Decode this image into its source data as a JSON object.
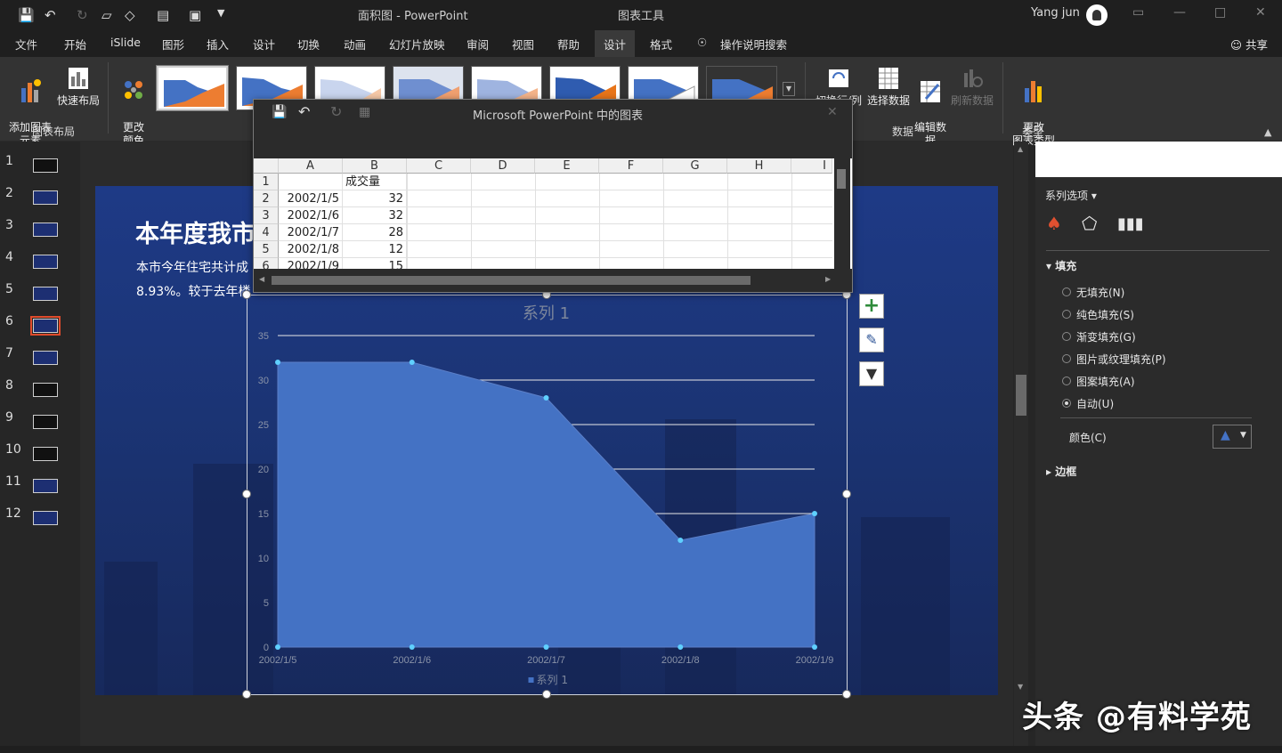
{
  "titlebar": {
    "doc_title": "面积图  -  PowerPoint",
    "tools_title": "图表工具",
    "user_name": "Yang jun"
  },
  "tabs": [
    {
      "label": "文件"
    },
    {
      "label": "开始"
    },
    {
      "label": "iSlide"
    },
    {
      "label": "图形"
    },
    {
      "label": "插入"
    },
    {
      "label": "设计"
    },
    {
      "label": "切换"
    },
    {
      "label": "动画"
    },
    {
      "label": "幻灯片放映"
    },
    {
      "label": "审阅"
    },
    {
      "label": "视图"
    },
    {
      "label": "帮助"
    },
    {
      "label": "设计"
    },
    {
      "label": "格式"
    }
  ],
  "tell_me": "操作说明搜索",
  "share": "共享",
  "ribbon": {
    "add_element": "添加图表\n元素",
    "quick_layout": "快速布局",
    "change_colors": "更改\n颜色",
    "group_layout": "图表布局",
    "switch_rowcol": "切换行/列",
    "select_data": "选择数据",
    "edit_data": "编辑数\n据",
    "refresh_data": "刷新数据",
    "group_data": "数据",
    "change_type": "更改\n图表类型",
    "group_type": "类型"
  },
  "slides": [
    "1",
    "2",
    "3",
    "4",
    "5",
    "6",
    "7",
    "8",
    "9",
    "10",
    "11",
    "12"
  ],
  "slide": {
    "title": "本年度我市",
    "line1": "本市今年住宅共计成",
    "line2": "8.93%。较于去年楼"
  },
  "excel": {
    "title": "Microsoft PowerPoint 中的图表",
    "columns": [
      "A",
      "B",
      "C",
      "D",
      "E",
      "F",
      "G",
      "H",
      "I"
    ],
    "rows": [
      "1",
      "2",
      "3",
      "4",
      "5",
      "6"
    ],
    "header_b": "成交量",
    "data": [
      {
        "a": "2002/1/5",
        "b": "32"
      },
      {
        "a": "2002/1/6",
        "b": "32"
      },
      {
        "a": "2002/1/7",
        "b": "28"
      },
      {
        "a": "2002/1/8",
        "b": "12"
      },
      {
        "a": "2002/1/9",
        "b": "15"
      }
    ]
  },
  "chart_data": {
    "type": "area",
    "title": "系列 1",
    "categories": [
      "2002/1/5",
      "2002/1/6",
      "2002/1/7",
      "2002/1/8",
      "2002/1/9"
    ],
    "series": [
      {
        "name": "系列 1",
        "values": [
          32,
          32,
          28,
          12,
          15
        ]
      }
    ],
    "y_ticks": [
      "0",
      "5",
      "10",
      "15",
      "20",
      "25",
      "30",
      "35"
    ],
    "ylim": [
      0,
      35
    ],
    "grid": true,
    "legend": "bottom",
    "fill_color": "#4472c4"
  },
  "format_pane": {
    "header": "系列选项",
    "fill_section": "填充",
    "options": [
      {
        "label": "无填充(N)",
        "on": false
      },
      {
        "label": "纯色填充(S)",
        "on": false
      },
      {
        "label": "渐变填充(G)",
        "on": false
      },
      {
        "label": "图片或纹理填充(P)",
        "on": false
      },
      {
        "label": "图案填充(A)",
        "on": false
      },
      {
        "label": "自动(U)",
        "on": true
      }
    ],
    "color_label": "颜色(C)",
    "border_section": "边框"
  },
  "watermark": "头条 @有料学苑"
}
